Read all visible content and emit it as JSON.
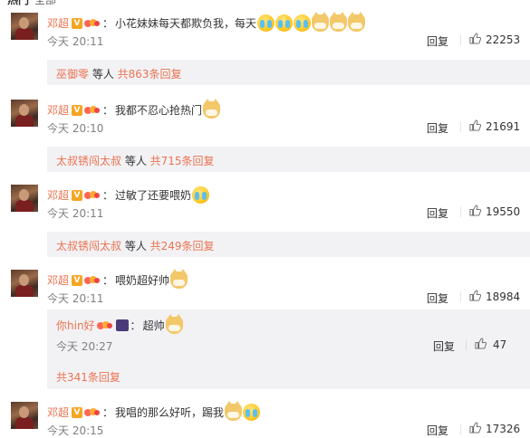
{
  "topbar": {
    "tab_hot": "热门",
    "tab_all": "全部"
  },
  "comments": [
    {
      "user": "邓超",
      "text": "小花妹妹每天都欺负我，每天",
      "emojis": [
        "cry-face",
        "cry-face",
        "cry-face",
        "doge",
        "doge",
        "doge"
      ],
      "time": "今天 20:11",
      "reply_label": "回复",
      "likes": "22253",
      "sub": {
        "names": "巫御零",
        "mid": " 等人 ",
        "count": "共863条回复"
      }
    },
    {
      "user": "邓超",
      "text": "我都不忍心抢热门",
      "emojis": [
        "doge"
      ],
      "time": "今天 20:10",
      "reply_label": "回复",
      "likes": "21691",
      "sub": {
        "names": "太叔锈闯太叔",
        "mid": " 等人 ",
        "count": "共715条回复"
      }
    },
    {
      "user": "邓超",
      "text": "过敏了还要喂奶",
      "emojis": [
        "cry-face"
      ],
      "time": "今天 20:11",
      "reply_label": "回复",
      "likes": "19550",
      "sub": {
        "names": "太叔锈闯太叔",
        "mid": " 等人 ",
        "count": "共249条回复"
      }
    },
    {
      "user": "邓超",
      "text": "喂奶超好帅",
      "emojis": [
        "doge"
      ],
      "time": "今天 20:11",
      "reply_label": "回复",
      "likes": "18984",
      "reply": {
        "user": "你hin好",
        "text": "超帅",
        "time": "今天 20:27",
        "reply_label": "回复",
        "likes": "47",
        "total": "共341条回复"
      }
    },
    {
      "user": "邓超",
      "text": "我唱的那么好听，踢我",
      "emojis": [
        "doge",
        "cry-face"
      ],
      "time": "今天 20:15",
      "reply_label": "回复",
      "likes": "17326"
    }
  ],
  "colors": {
    "username": "#eb7350",
    "subbox_bg": "#f2f2f5",
    "time": "#808080"
  }
}
